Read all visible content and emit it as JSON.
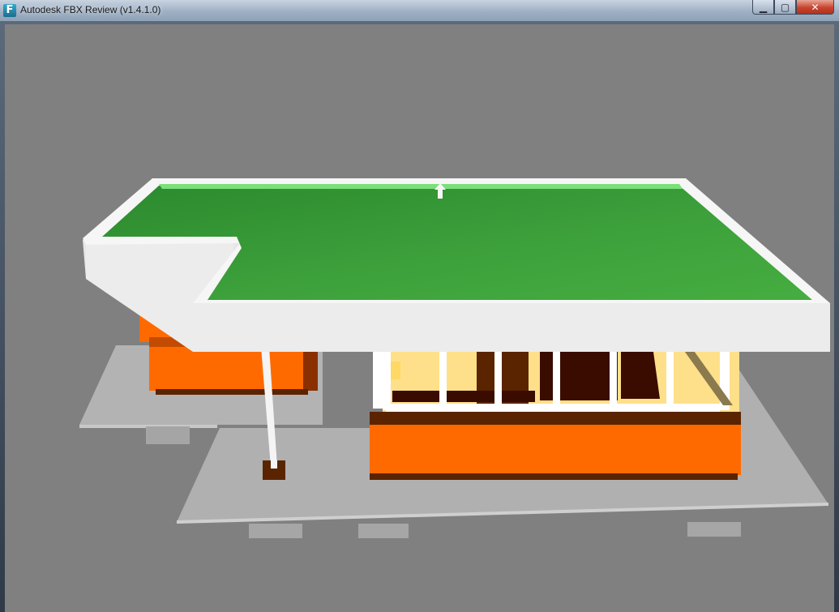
{
  "window": {
    "title": "Autodesk FBX Review (v1.4.1.0)",
    "app_icon_glyph": "F",
    "controls": {
      "minimize_icon": "minimize-icon",
      "maximize_icon": "maximize-icon",
      "close_icon": "close-icon",
      "minimize_glyph": "▁",
      "maximize_glyph": "▢",
      "close_glyph": "✕"
    }
  },
  "viewport": {
    "background_color": "#808080",
    "model_colors": {
      "roof": "#3ea23c",
      "roof_trim": "#f2f2f2",
      "walls": "#ff6a00",
      "base_trim": "#5a2400",
      "glass": "#ffe08a",
      "interior": "#3a0c00",
      "ground": "#b2b2b2"
    }
  }
}
